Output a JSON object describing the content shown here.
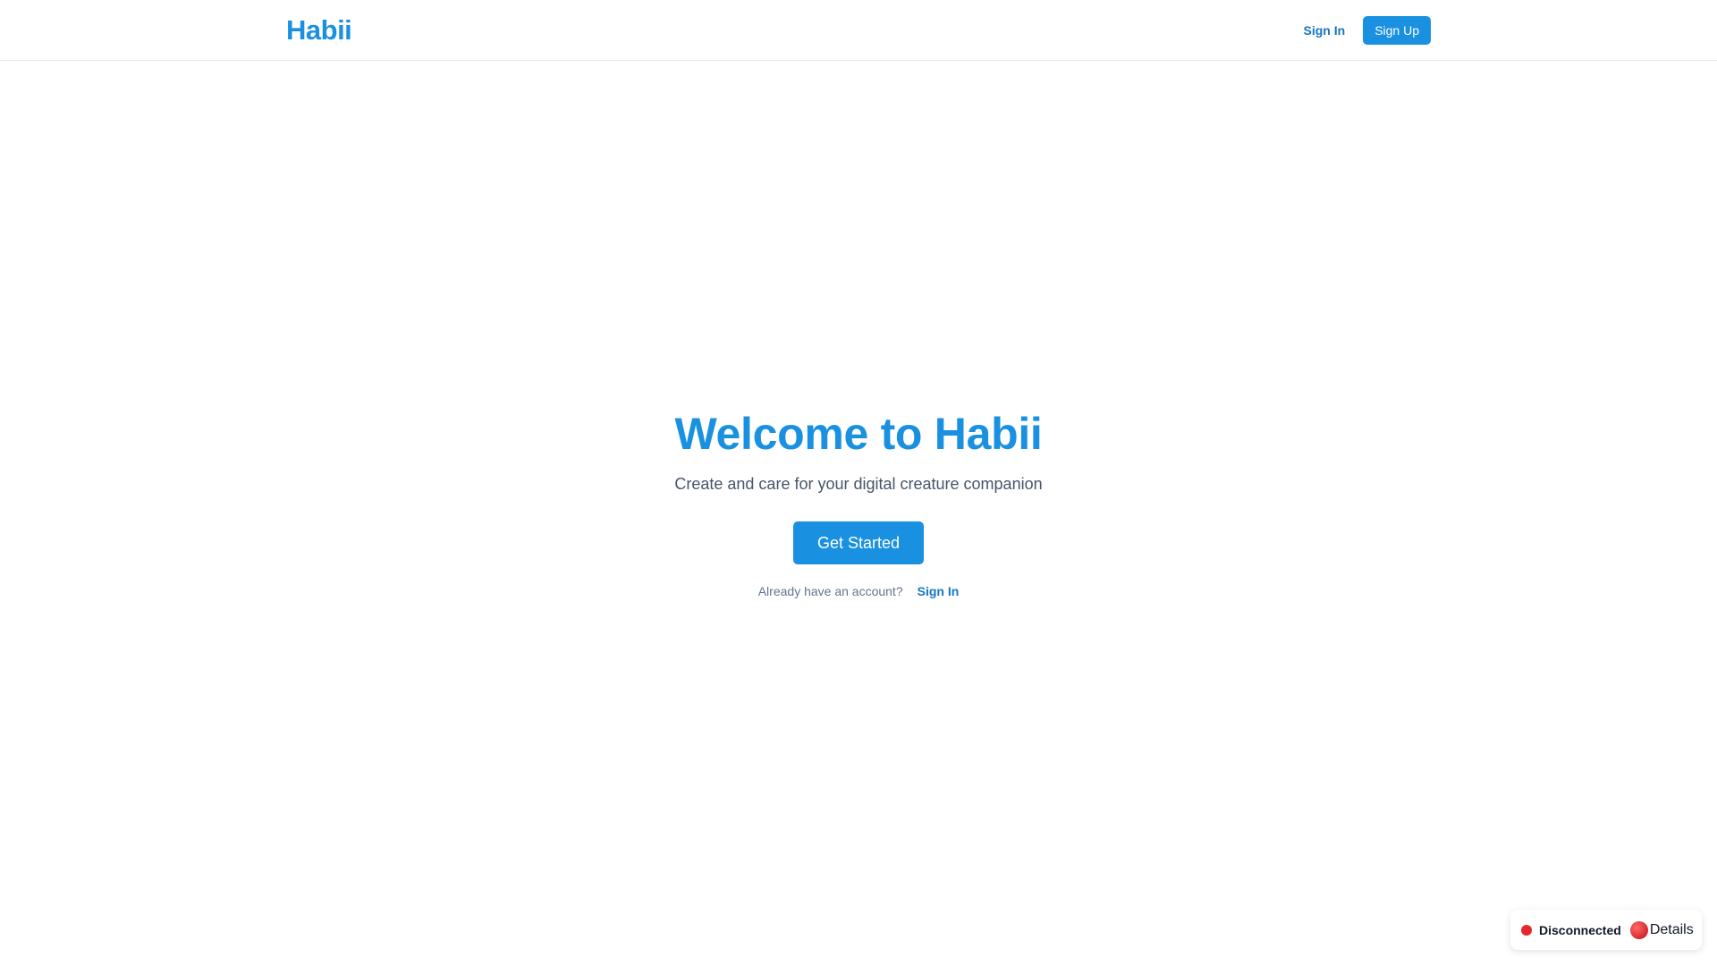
{
  "header": {
    "logo": "Habii",
    "sign_in_label": "Sign In",
    "sign_up_label": "Sign Up"
  },
  "hero": {
    "title": "Welcome to Habii",
    "subtitle": "Create and care for your digital creature companion",
    "cta_label": "Get Started",
    "signin_prompt": "Already have an account?",
    "signin_link": "Sign In"
  },
  "status": {
    "text": "Disconnected",
    "details_label": "Details",
    "dot_icon": "status-dot-icon",
    "details_icon": "red-circle-icon"
  },
  "colors": {
    "accent": "#1a91e0",
    "link": "#1577c0",
    "status_error": "#e5262b"
  }
}
